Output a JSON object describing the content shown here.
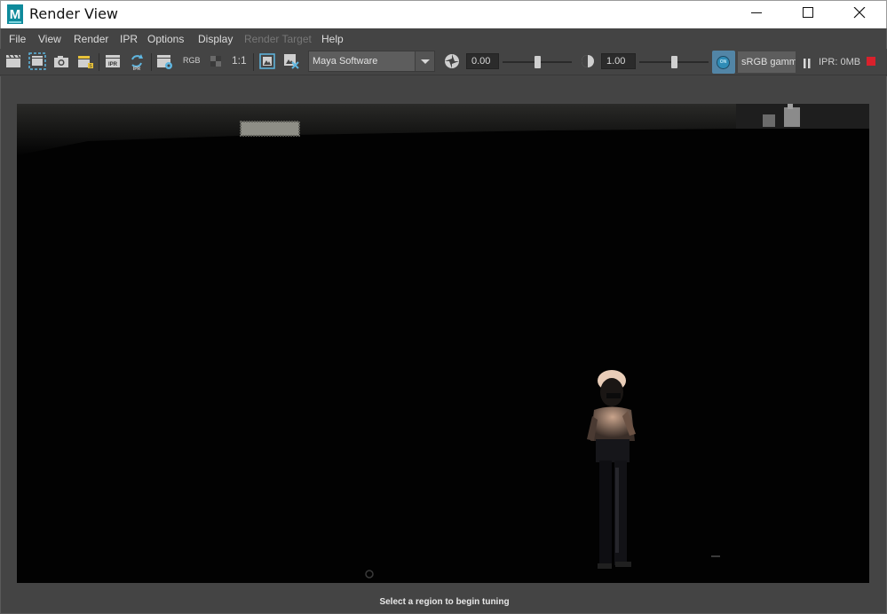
{
  "window": {
    "title": "Render View",
    "app_icon_letter": "M"
  },
  "menu": {
    "items": [
      {
        "label": "File",
        "enabled": true
      },
      {
        "label": "View",
        "enabled": true
      },
      {
        "label": "Render",
        "enabled": true
      },
      {
        "label": "IPR",
        "enabled": true
      },
      {
        "label": "Options",
        "enabled": true
      },
      {
        "label": "Display",
        "enabled": true
      },
      {
        "label": "Render Target",
        "enabled": false
      },
      {
        "label": "Help",
        "enabled": true
      }
    ]
  },
  "toolbar": {
    "rgb_label": "RGB",
    "ratio_label": "1:1",
    "ipr_icon_label": "IPR",
    "renderer": "Maya Software",
    "exposure_value": "0.00",
    "gamma_value": "1.00",
    "exposure_level": 0.5,
    "gamma_level": 0.5,
    "color_mgmt_badge": "ON",
    "color_space": "sRGB gamma",
    "ipr_memory": "IPR: 0MB",
    "colors": {
      "color_mgmt_active": "#5285a6",
      "stop_button": "#d9212c"
    }
  },
  "status": {
    "message": "Select a region to begin tuning"
  }
}
